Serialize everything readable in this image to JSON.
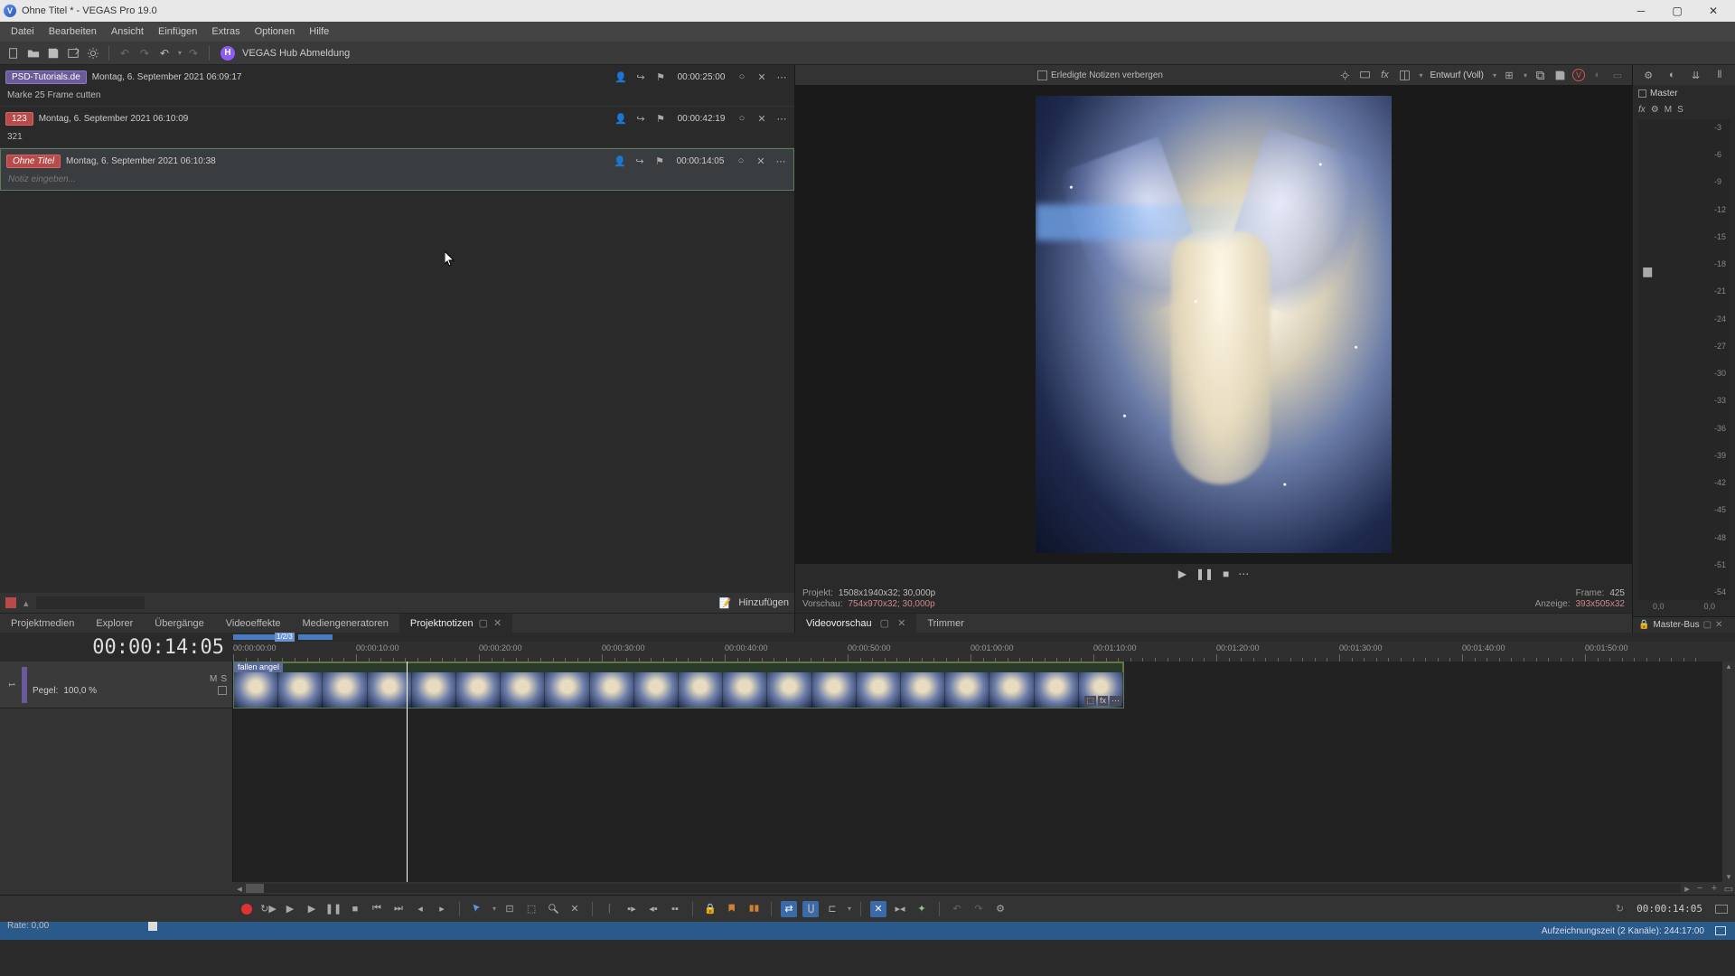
{
  "window": {
    "title": "Ohne Titel * - VEGAS Pro 19.0",
    "app_letter": "V"
  },
  "menubar": [
    "Datei",
    "Bearbeiten",
    "Ansicht",
    "Einfügen",
    "Extras",
    "Optionen",
    "Hilfe"
  ],
  "toolbar": {
    "hub_letter": "H",
    "hub_text": "VEGAS Hub Abmeldung"
  },
  "preview_toolbar": {
    "hide_done_label": "Erledigte Notizen verbergen",
    "draft_label": "Entwurf (Voll)"
  },
  "notes": [
    {
      "chip": "PSD-Tutorials.de",
      "chip_class": "chip-purple",
      "date": "Montag, 6. September 2021 06:09:17",
      "time": "00:00:25:00",
      "body": "Marke 25 Frame cutten",
      "placeholder": false,
      "selected": false
    },
    {
      "chip": "123",
      "chip_class": "chip-red",
      "date": "Montag, 6. September 2021 06:10:09",
      "time": "00:00:42:19",
      "body": "321",
      "placeholder": false,
      "selected": false
    },
    {
      "chip": "Ohne Titel",
      "chip_class": "chip-red-italic",
      "date": "Montag, 6. September 2021 06:10:38",
      "time": "00:00:14:05",
      "body": "Notiz eingeben...",
      "placeholder": true,
      "selected": true
    }
  ],
  "notes_footer": {
    "add_label": "Hinzufügen"
  },
  "left_tabs": [
    "Projektmedien",
    "Explorer",
    "Übergänge",
    "Videoeffekte",
    "Mediengeneratoren",
    "Projektnotizen"
  ],
  "left_active_tab": "Projektnotizen",
  "preview_info": {
    "projekt_k": "Projekt:",
    "projekt_v": "1508x1940x32; 30,000p",
    "vorschau_k": "Vorschau:",
    "vorschau_v": "754x970x32; 30,000p",
    "frame_k": "Frame:",
    "frame_v": "425",
    "anzeige_k": "Anzeige:",
    "anzeige_v": "393x505x32"
  },
  "preview_tabs": {
    "videovorschau": "Videovorschau",
    "trimmer": "Trimmer"
  },
  "master": {
    "title": "Master",
    "fx": "fx",
    "btns": [
      "M",
      "S"
    ],
    "scale": [
      "-3",
      "-6",
      "-9",
      "-12",
      "-15",
      "-18",
      "-21",
      "-24",
      "-27",
      "-30",
      "-33",
      "-36",
      "-39",
      "-42",
      "-45",
      "-48",
      "-51",
      "-54"
    ],
    "bottom_l": "0,0",
    "bottom_r": "0,0",
    "bus_tab": "Master-Bus",
    "hold": "▮▮"
  },
  "timeline": {
    "timecode": "00:00:14:05",
    "region_tag": "1/2/3",
    "ruler": [
      "00:00:00:00",
      "00:00:10:00",
      "00:00:20:00",
      "00:00:30:00",
      "00:00:40:00",
      "00:00:50:00",
      "00:01:00:00",
      "00:01:10:00",
      "00:01:20:00",
      "00:01:30:00",
      "00:01:40:00",
      "00:01:50:00"
    ],
    "track": {
      "num": "1",
      "m": "M",
      "s": "S",
      "pegel_k": "Pegel:",
      "pegel_v": "100,0 %"
    },
    "clip_label": "fallen angel",
    "clip_fx": [
      "⬚",
      "fx",
      "⋯"
    ]
  },
  "rate": {
    "label": "Rate: 0,00"
  },
  "bottom_timecode": "00:00:14:05",
  "status": {
    "rec_time": "Aufzeichnungszeit (2 Kanäle): 244:17:00"
  }
}
